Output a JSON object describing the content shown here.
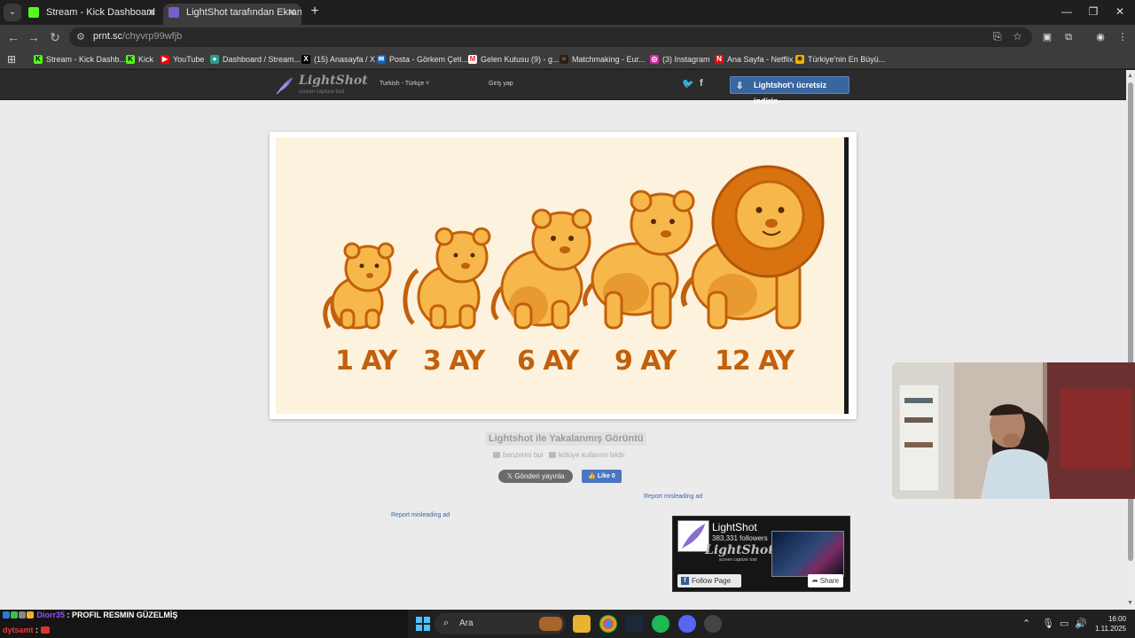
{
  "browser": {
    "tabs": [
      {
        "title": "Stream - Kick Dashboard",
        "active": false
      },
      {
        "title": "LightShot tarafından Ekran Görü",
        "active": true
      }
    ],
    "url_domain": "prnt.sc",
    "url_path": "/chyvrp99wfjb",
    "bookmarks": [
      "Stream - Kick Dashb...",
      "Kick",
      "YouTube",
      "Dashboard / Stream...",
      "(15) Anasayfa / X",
      "Posta - Görkem Çeti...",
      "Gelen Kutusu (9) - g...",
      "Matchmaking - Eur...",
      "(3) Instagram",
      "Ana Sayfa - Netflix",
      "Türkiye'nin En Büyü..."
    ]
  },
  "lightshot": {
    "logo_name": "LightShot",
    "logo_tagline": "screen capture tool",
    "language": "Turkish - Türkçe",
    "login": "Giriş yap",
    "download_button": "Lightshot'ı ücretsiz indirin",
    "caption": "Lightshot ile Yakalanmış Görüntü",
    "find_similar": "benzerini bul",
    "report_abuse": "kötüye kullanım bildir",
    "tweet_button": "Gönderi yayınla",
    "like_button": "Like 0",
    "report_ad_1": "Report misleading ad",
    "report_ad_2": "Report misleading ad"
  },
  "screenshot_content": {
    "ages": [
      "1 AY",
      "3 AY",
      "6 AY",
      "9 AY",
      "12 AY"
    ],
    "colors": {
      "background": "#fdf2dd",
      "lion": "#f7b84b",
      "outline": "#c2600c",
      "mane": "#d9730f"
    }
  },
  "facebook_widget": {
    "page_name": "LightShot",
    "followers": "383,331 followers",
    "follow_button": "Follow Page",
    "share_button": "Share"
  },
  "chat": {
    "line1_user": "Diorr35",
    "line1_msg": ": PROFIL RESMIN GÜZELMİŞ",
    "line2_user": "dytsamt",
    "line2_msg": ":"
  },
  "taskbar": {
    "search_placeholder": "Ara",
    "time": "16:00",
    "date": "1.11.2025"
  }
}
